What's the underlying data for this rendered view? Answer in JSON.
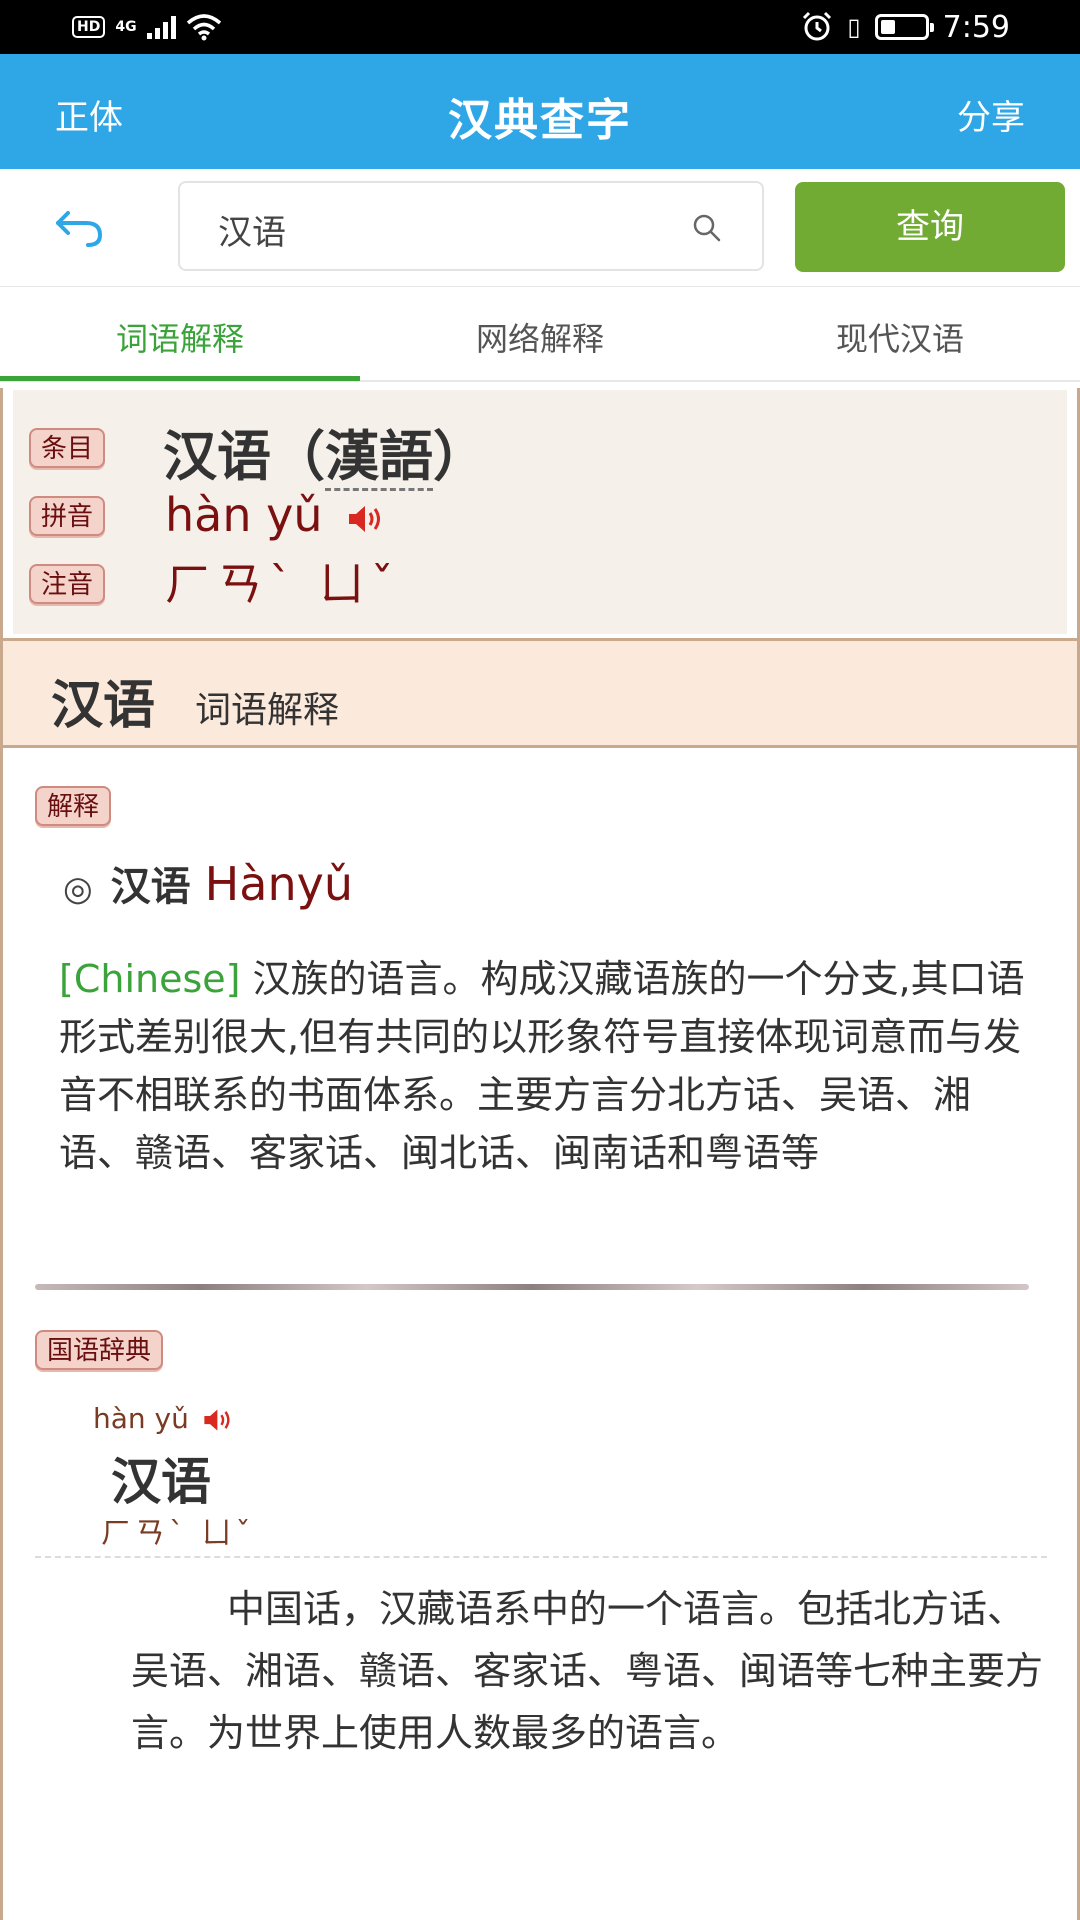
{
  "status_bar": {
    "hd": "HD",
    "network": "4G",
    "time": "7:59"
  },
  "app_bar": {
    "left": "正体",
    "title": "汉典查字",
    "right": "分享"
  },
  "search": {
    "value": "汉语",
    "button": "查询"
  },
  "tabs": [
    {
      "label": "词语解释",
      "active": true
    },
    {
      "label": "网络解释",
      "active": false
    },
    {
      "label": "现代汉语",
      "active": false
    }
  ],
  "header": {
    "tags": [
      "条目",
      "拼音",
      "注音"
    ],
    "word": "汉语",
    "word_trad_open": "（",
    "word_trad": "漢語",
    "word_trad_close": "）",
    "pinyin": "hàn yǔ",
    "zhuyin": "ㄏㄢˋ ㄩˇ"
  },
  "section": {
    "word": "汉语",
    "subtitle": "词语解释"
  },
  "definition": {
    "tag": "解释",
    "ring": "◎",
    "word": "汉语",
    "pinyin": "Hànyǔ",
    "english": "[Chinese]",
    "text": " 汉族的语言。构成汉藏语族的一个分支,其口语形式差别很大,但有共同的以形象符号直接体现词意而与发音不相联系的书面体系。主要方言分北方话、吴语、湘语、赣语、客家话、闽北话、闽南话和粤语等"
  },
  "guoyu": {
    "tag": "国语辞典",
    "pinyin": "hàn yǔ",
    "word": "汉语",
    "zhuyin": "ㄏㄢˋ ㄩˇ",
    "text": "中国话，汉藏语系中的一个语言。包括北方话、吴语、湘语、赣语、客家话、粤语、闽语等七种主要方言。为世界上使用人数最多的语言。"
  },
  "colors": {
    "app_bar": "#2fa6e6",
    "query_button": "#72ab33",
    "tab_active": "#3aa33a",
    "pinyin": "#7a1010",
    "tag_bg": "#f4d3cb",
    "section_bg": "#fbe9dc"
  },
  "icons": [
    "back-arrow-icon",
    "search-icon",
    "speaker-icon",
    "alarm-icon",
    "vibrate-icon",
    "battery-icon",
    "wifi-icon",
    "signal-icon"
  ]
}
